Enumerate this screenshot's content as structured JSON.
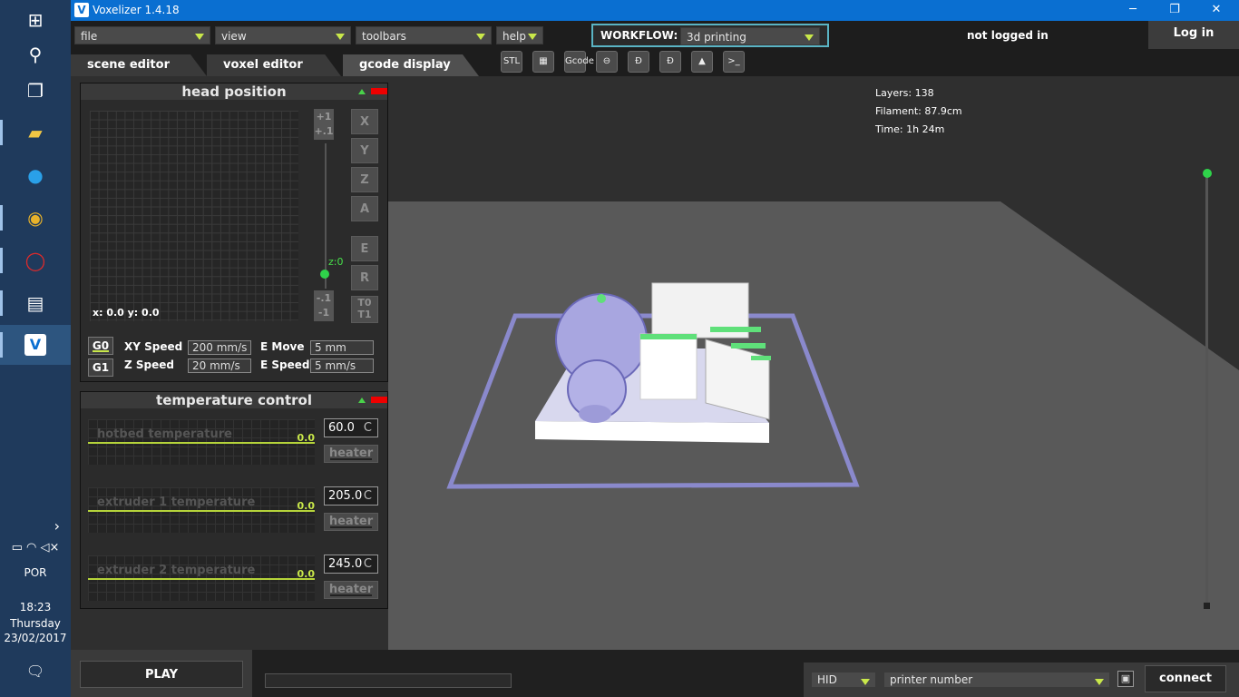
{
  "window": {
    "title": "Voxelizer 1.4.18",
    "logo": "V"
  },
  "menus": {
    "file": "file",
    "view": "view",
    "toolbars": "toolbars",
    "help": "help"
  },
  "workflow": {
    "label": "WORKFLOW:",
    "value": "3d printing"
  },
  "account": {
    "status": "not logged in",
    "login": "Log in"
  },
  "tabs": {
    "scene": "scene editor",
    "voxel": "voxel editor",
    "gcode": "gcode display"
  },
  "toolbar_icons": [
    "stl-import-icon",
    "checker-icon",
    "gcode-folder-icon",
    "nozzle-icon",
    "print-icon",
    "print-alt-icon",
    "prism-icon",
    "console-icon"
  ],
  "toolbar_labels": {
    "stl": "STL",
    "gcode": "Gcode",
    "console": ">_"
  },
  "stats": {
    "layers": "Layers: 138",
    "filament": "Filament: 87.9cm",
    "time": "Time: 1h 24m"
  },
  "head": {
    "title": "head position",
    "readout": "x: 0.0 y: 0.0",
    "up1": "+1",
    "up01": "+.1",
    "down01": "-.1",
    "down1": "-1",
    "z_label": "z:0",
    "axes": {
      "x": "X",
      "y": "Y",
      "z": "Z",
      "a": "A",
      "e": "E",
      "r": "R",
      "t0": "T0",
      "t1": "T1"
    },
    "g0": "G0",
    "g1": "G1",
    "xy_speed_label": "XY Speed",
    "xy_speed": "200 mm/s",
    "z_speed_label": "Z Speed",
    "z_speed": "20 mm/s",
    "e_move_label": "E Move",
    "e_move": "5 mm",
    "e_speed_label": "E Speed",
    "e_speed": "5 mm/s"
  },
  "temperature": {
    "title": "temperature control",
    "unit": "C",
    "heater": "heater",
    "rows": [
      {
        "label": "hotbed temperature",
        "current": "0.0",
        "target": "60.0"
      },
      {
        "label": "extruder 1 temperature",
        "current": "0.0",
        "target": "205.0"
      },
      {
        "label": "extruder 2 temperature",
        "current": "0.0",
        "target": "245.0"
      }
    ]
  },
  "bottom": {
    "play": "PLAY",
    "port": "HID",
    "printer": "printer number",
    "connect": "connect"
  },
  "os": {
    "lang": "POR",
    "time": "18:23",
    "day": "Thursday",
    "date": "23/02/2017"
  }
}
